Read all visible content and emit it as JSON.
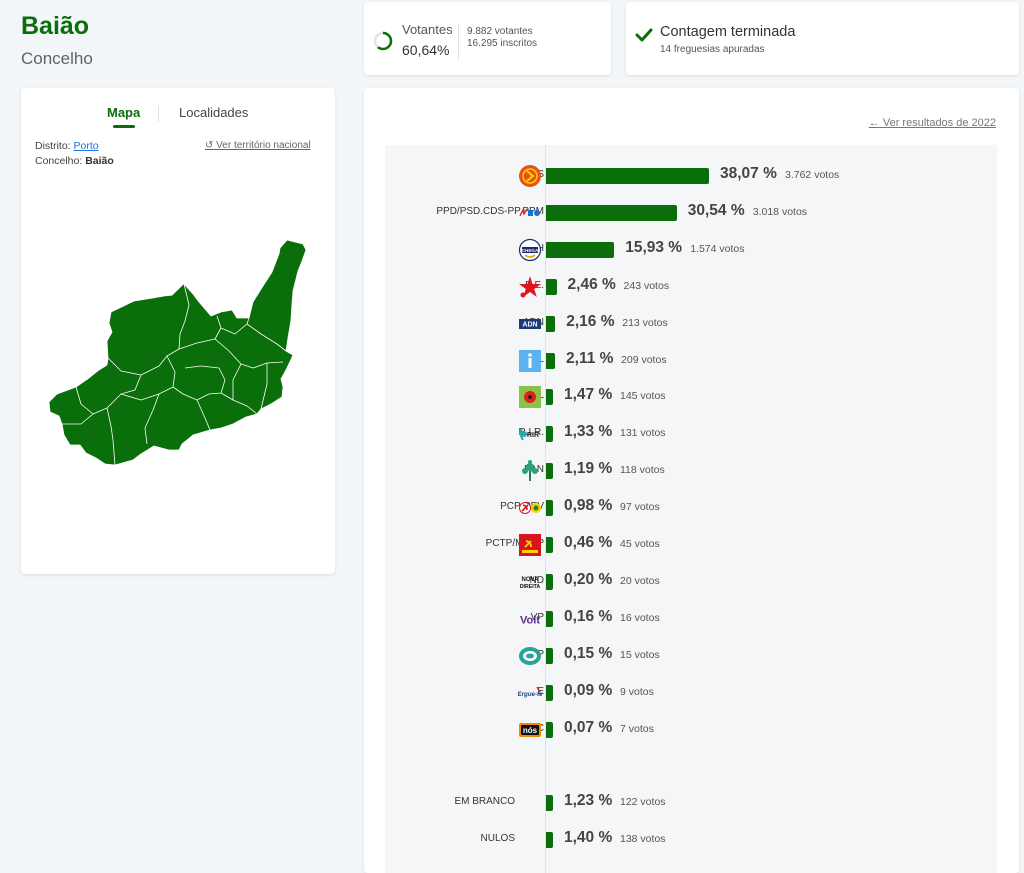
{
  "header": {
    "title": "Baião",
    "subtitle": "Concelho"
  },
  "turnout": {
    "label": "Votantes",
    "percent": "60,64%",
    "voters": "9.882 votantes",
    "registered": "16.295 inscritos",
    "fraction": 0.6064
  },
  "counting": {
    "title": "Contagem terminada",
    "subtitle": "14 freguesias apuradas"
  },
  "map_panel": {
    "tabs": [
      "Mapa",
      "Localidades"
    ],
    "active_tab": "Mapa",
    "district_label": "Distrito:",
    "district_value": "Porto",
    "municipality_label": "Concelho:",
    "municipality_value": "Baião",
    "national_link": "Ver território nacional",
    "map_color": "#0a6e0a"
  },
  "results": {
    "previous_link": "Ver resultados de 2022",
    "bar_color": "#0a6e0a",
    "parties": [
      {
        "name": "PS",
        "pct": 38.07,
        "pct_label": "38,07 %",
        "votes": "3.762 votos",
        "logo": "ps-icon"
      },
      {
        "name": "PPD/PSD.CDS-PP.PPM",
        "pct": 30.54,
        "pct_label": "30,54 %",
        "votes": "3.018 votos",
        "logo": "ad-icon"
      },
      {
        "name": "CH",
        "pct": 15.93,
        "pct_label": "15,93 %",
        "votes": "1.574 votos",
        "logo": "chega-icon"
      },
      {
        "name": "B.E.",
        "pct": 2.46,
        "pct_label": "2,46 %",
        "votes": "243 votos",
        "logo": "be-icon"
      },
      {
        "name": "ADN",
        "pct": 2.16,
        "pct_label": "2,16 %",
        "votes": "213 votos",
        "logo": "adn-icon"
      },
      {
        "name": "IL",
        "pct": 2.11,
        "pct_label": "2,11 %",
        "votes": "209 votos",
        "logo": "il-icon"
      },
      {
        "name": "L",
        "pct": 1.47,
        "pct_label": "1,47 %",
        "votes": "145 votos",
        "logo": "livre-icon"
      },
      {
        "name": "R.I.R.",
        "pct": 1.33,
        "pct_label": "1,33 %",
        "votes": "131 votos",
        "logo": "rir-icon"
      },
      {
        "name": "PAN",
        "pct": 1.19,
        "pct_label": "1,19 %",
        "votes": "118 votos",
        "logo": "pan-icon"
      },
      {
        "name": "PCP-PEV",
        "pct": 0.98,
        "pct_label": "0,98 %",
        "votes": "97 votos",
        "logo": "cdu-icon"
      },
      {
        "name": "PCTP/MRPP",
        "pct": 0.46,
        "pct_label": "0,46 %",
        "votes": "45 votos",
        "logo": "pctp-icon"
      },
      {
        "name": "ND",
        "pct": 0.2,
        "pct_label": "0,20 %",
        "votes": "20 votos",
        "logo": "nd-icon"
      },
      {
        "name": "VP",
        "pct": 0.16,
        "pct_label": "0,16 %",
        "votes": "16 votos",
        "logo": "volt-icon"
      },
      {
        "name": "JPP",
        "pct": 0.15,
        "pct_label": "0,15 %",
        "votes": "15 votos",
        "logo": "jpp-icon"
      },
      {
        "name": "E",
        "pct": 0.09,
        "pct_label": "0,09 %",
        "votes": "9 votos",
        "logo": "ergue-te-icon"
      },
      {
        "name": "NC",
        "pct": 0.07,
        "pct_label": "0,07 %",
        "votes": "7 votos",
        "logo": "nc-icon"
      }
    ],
    "other": [
      {
        "name": "EM BRANCO",
        "pct": 1.23,
        "pct_label": "1,23 %",
        "votes": "122 votos"
      },
      {
        "name": "NULOS",
        "pct": 1.4,
        "pct_label": "1,40 %",
        "votes": "138 votos"
      }
    ],
    "logo_labels": {
      "adn": "ADN",
      "volt": "Volt",
      "nd": "NOVA DIREITA",
      "nc": "nós",
      "ergue": "Ergue-te",
      "rir": "RIR",
      "chega": "CHEGA"
    }
  }
}
